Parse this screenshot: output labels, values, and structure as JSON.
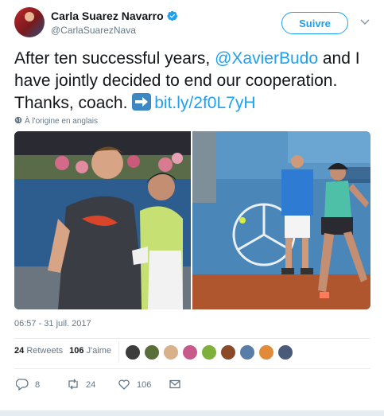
{
  "user": {
    "display_name": "Carla Suarez Navarro",
    "handle": "@CarlaSuarezNava",
    "follow_label": "Suivre"
  },
  "tweet": {
    "text_part1": "After ten successful years, ",
    "mention": "@XavierBudo",
    "text_part2": " and I have jointly decided to end our cooperation. Thanks, coach. ",
    "link": "bit.ly/2f0L7yH",
    "translate_label": "À l'origine en anglais"
  },
  "timestamp": "06:57 - 31 juil. 2017",
  "stats": {
    "retweets_count": "24",
    "retweets_label": "Retweets",
    "likes_count": "106",
    "likes_label": "J'aime"
  },
  "actions": {
    "reply_count": "8",
    "retweet_count": "24",
    "like_count": "106"
  },
  "colors": {
    "accent": "#1da1f2",
    "text": "#14171a",
    "muted": "#657786",
    "divider": "#e6ecf0"
  },
  "likers": [
    "liker-1",
    "liker-2",
    "liker-3",
    "liker-4",
    "liker-5",
    "liker-6",
    "liker-7",
    "liker-8",
    "liker-9"
  ]
}
